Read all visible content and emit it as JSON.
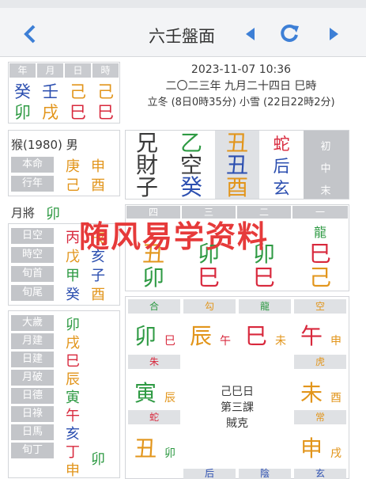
{
  "colors": {
    "blue": "#2c4fb0",
    "green": "#2e9a43",
    "red": "#d8283c",
    "orange": "#e2951b",
    "accent": "#3d7fd6"
  },
  "header": {
    "title": "六壬盤面",
    "back_icon": "chevron-left-icon",
    "prev_icon": "triangle-left-icon",
    "refresh_icon": "refresh-icon",
    "next_icon": "triangle-right-icon"
  },
  "datetime": {
    "line1": "2023-11-07 10:36",
    "line2": "二〇二三年 九月二十四日 巳時",
    "line3": "立冬 (8日0時35分) 小雪 (22日22時2分)"
  },
  "pillars": {
    "labels": [
      "年",
      "月",
      "日",
      "時"
    ],
    "stems": [
      "癸",
      "壬",
      "己",
      "己"
    ],
    "branches": [
      "卯",
      "戌",
      "巳",
      "巳"
    ]
  },
  "person": {
    "title": "猴(1980) 男",
    "rows": [
      {
        "label": "本命",
        "a": "庚",
        "b": "申"
      },
      {
        "label": "行年",
        "a": "己",
        "b": "酉"
      }
    ]
  },
  "month_general": {
    "label": "月將",
    "value": "卯"
  },
  "void": {
    "rows": [
      {
        "label": "日空",
        "a": "丙",
        "b": "戌"
      },
      {
        "label": "時空",
        "a": "戊",
        "b": "亥"
      },
      {
        "label": "旬首",
        "a": "甲",
        "b": "子"
      },
      {
        "label": "旬尾",
        "a": "癸",
        "b": "酉"
      }
    ]
  },
  "gods": {
    "rows": [
      {
        "label": "大歲",
        "v": "卯"
      },
      {
        "label": "月建",
        "v": "戌"
      },
      {
        "label": "日建",
        "v": "巳"
      },
      {
        "label": "月破",
        "v": "辰"
      },
      {
        "label": "日德",
        "v": "寅"
      },
      {
        "label": "日祿",
        "v": "午"
      },
      {
        "label": "日馬",
        "v": "亥"
      },
      {
        "label": "旬丁",
        "v": "丁",
        "extra": "卯"
      },
      {
        "label": "",
        "v": "申"
      }
    ]
  },
  "transmissions": {
    "col1": [
      "兄",
      "財",
      "子"
    ],
    "col2": [
      "乙",
      "空",
      "癸"
    ],
    "col3": [
      "丑",
      "丑",
      "酉"
    ],
    "col4": [
      "蛇",
      "后",
      "玄"
    ],
    "col5": [
      "初",
      "中",
      "末"
    ]
  },
  "lessons": {
    "headers": [
      "四",
      "三",
      "二",
      "一"
    ],
    "top": [
      "",
      "",
      "",
      "龍"
    ],
    "r1": [
      "丑",
      "卯",
      "卯",
      "巳"
    ],
    "r2": [
      "卯",
      "巳",
      "巳",
      "己"
    ]
  },
  "heaven": {
    "top_labels": [
      "合",
      "勾",
      "龍",
      "空"
    ],
    "top": [
      {
        "big": "卯",
        "small": "巳"
      },
      {
        "big": "辰",
        "small": "午"
      },
      {
        "big": "巳",
        "small": "未"
      },
      {
        "big": "午",
        "small": "申"
      }
    ],
    "left_labels": [
      "朱",
      "蛇"
    ],
    "left": [
      {
        "big": "寅",
        "small": "辰"
      },
      {
        "big": "丑",
        "small": "卯"
      }
    ],
    "right_labels": [
      "虎",
      "常"
    ],
    "right": [
      {
        "big": "未",
        "small": "酉"
      },
      {
        "big": "申",
        "small": "戌"
      }
    ],
    "center": [
      "己巳日",
      "第三課",
      "賊克"
    ],
    "bottom_labels": [
      "",
      "后",
      "陰",
      "玄"
    ]
  },
  "watermark": "随风易学资料"
}
